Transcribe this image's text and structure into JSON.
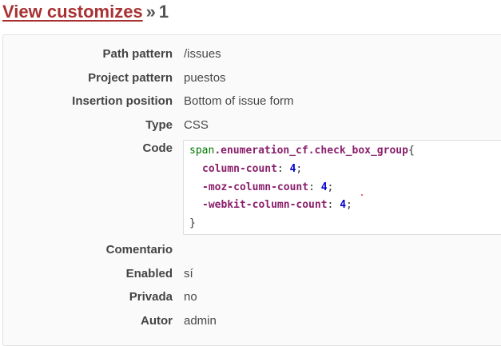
{
  "breadcrumb": {
    "link_label": "View customizes",
    "separator": "»",
    "current": "1"
  },
  "details": {
    "path_pattern": {
      "label": "Path pattern",
      "value": "/issues"
    },
    "project_pattern": {
      "label": "Project pattern",
      "value": "puestos"
    },
    "insertion_position": {
      "label": "Insertion position",
      "value": "Bottom of issue form"
    },
    "type": {
      "label": "Type",
      "value": "CSS"
    },
    "code": {
      "label": "Code",
      "selector_tag": "span",
      "selector_class": ".enumeration_cf.check_box_group",
      "open_brace": "{",
      "close_brace": "}",
      "declarations": [
        {
          "property": "column-count",
          "value": "4"
        },
        {
          "property": "-moz-column-count",
          "value": "4"
        },
        {
          "property": "-webkit-column-count",
          "value": "4"
        }
      ]
    },
    "comentario": {
      "label": "Comentario",
      "value": ""
    },
    "enabled": {
      "label": "Enabled",
      "value": "sí"
    },
    "privada": {
      "label": "Privada",
      "value": "no"
    },
    "autor": {
      "label": "Autor",
      "value": "admin"
    }
  },
  "colors": {
    "link": "#a83232",
    "code_tag": "#007700",
    "code_property": "#8a1f6b",
    "code_number": "#0000cc"
  }
}
